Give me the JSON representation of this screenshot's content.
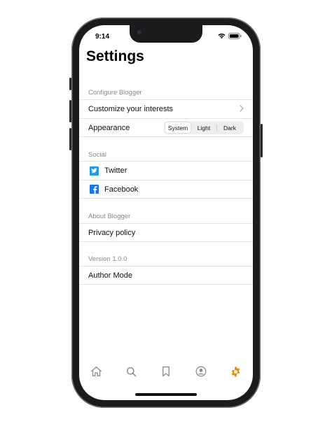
{
  "status": {
    "time": "9:14"
  },
  "page": {
    "title": "Settings"
  },
  "sections": {
    "configure": {
      "header": "Configure Blogger",
      "interests_label": "Customize your interests",
      "appearance_label": "Appearance",
      "appearance_options": [
        "System",
        "Light",
        "Dark"
      ],
      "appearance_selected": "System"
    },
    "social": {
      "header": "Social",
      "twitter_label": "Twitter",
      "facebook_label": "Facebook"
    },
    "about": {
      "header": "About Blogger",
      "privacy_label": "Privacy policy"
    },
    "version": {
      "header": "Version 1.0.0",
      "author_mode_label": "Author Mode"
    }
  },
  "tabbar": {
    "items": [
      {
        "icon": "home-icon",
        "active": false
      },
      {
        "icon": "search-icon",
        "active": false
      },
      {
        "icon": "bookmark-icon",
        "active": false
      },
      {
        "icon": "profile-icon",
        "active": false
      },
      {
        "icon": "gear-icon",
        "active": true
      }
    ]
  },
  "colors": {
    "accent": "#f28c00",
    "inactive_tab": "#8e8e93",
    "twitter": "#1d9bf0",
    "facebook": "#1877f2",
    "section_header": "#8a8a8e"
  }
}
